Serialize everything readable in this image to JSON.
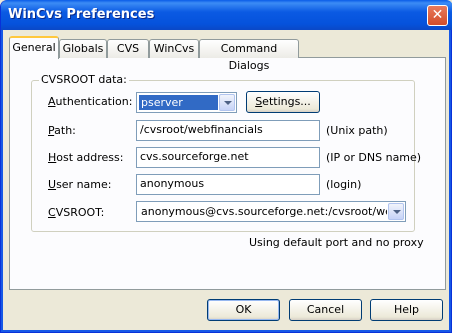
{
  "window": {
    "title": "WinCvs Preferences",
    "close_icon": "close-icon"
  },
  "tabs": [
    {
      "label": "General",
      "active": true
    },
    {
      "label": "Globals",
      "active": false
    },
    {
      "label": "CVS",
      "active": false
    },
    {
      "label": "WinCvs",
      "active": false
    },
    {
      "label": "Command Dialogs",
      "active": false
    }
  ],
  "group": {
    "title": "CVSROOT data:"
  },
  "fields": {
    "authentication": {
      "label_pre": "",
      "label_u": "A",
      "label_post": "uthentication:",
      "value": "pserver",
      "settings_pre": "",
      "settings_u": "S",
      "settings_post": "ettings..."
    },
    "path": {
      "label_pre": "",
      "label_u": "P",
      "label_post": "ath:",
      "value": "/cvsroot/webfinancials",
      "hint": "(Unix path)"
    },
    "host": {
      "label_pre": "",
      "label_u": "H",
      "label_post": "ost address:",
      "value": "cvs.sourceforge.net",
      "hint": "(IP or DNS name)"
    },
    "user": {
      "label_pre": "",
      "label_u": "U",
      "label_post": "ser name:",
      "value": "anonymous",
      "hint": "(login)"
    },
    "cvsroot": {
      "label_pre": "",
      "label_u": "C",
      "label_post": "VSROOT:",
      "value": "anonymous@cvs.sourceforge.net:/cvsroot/webfinan"
    }
  },
  "status_note": "Using default port and no proxy",
  "buttons": {
    "ok": "OK",
    "cancel": "Cancel",
    "help": "Help"
  },
  "colors": {
    "title_bar": "#0554dc",
    "selection": "#316ac5",
    "tab_highlight": "#ffc83c"
  }
}
